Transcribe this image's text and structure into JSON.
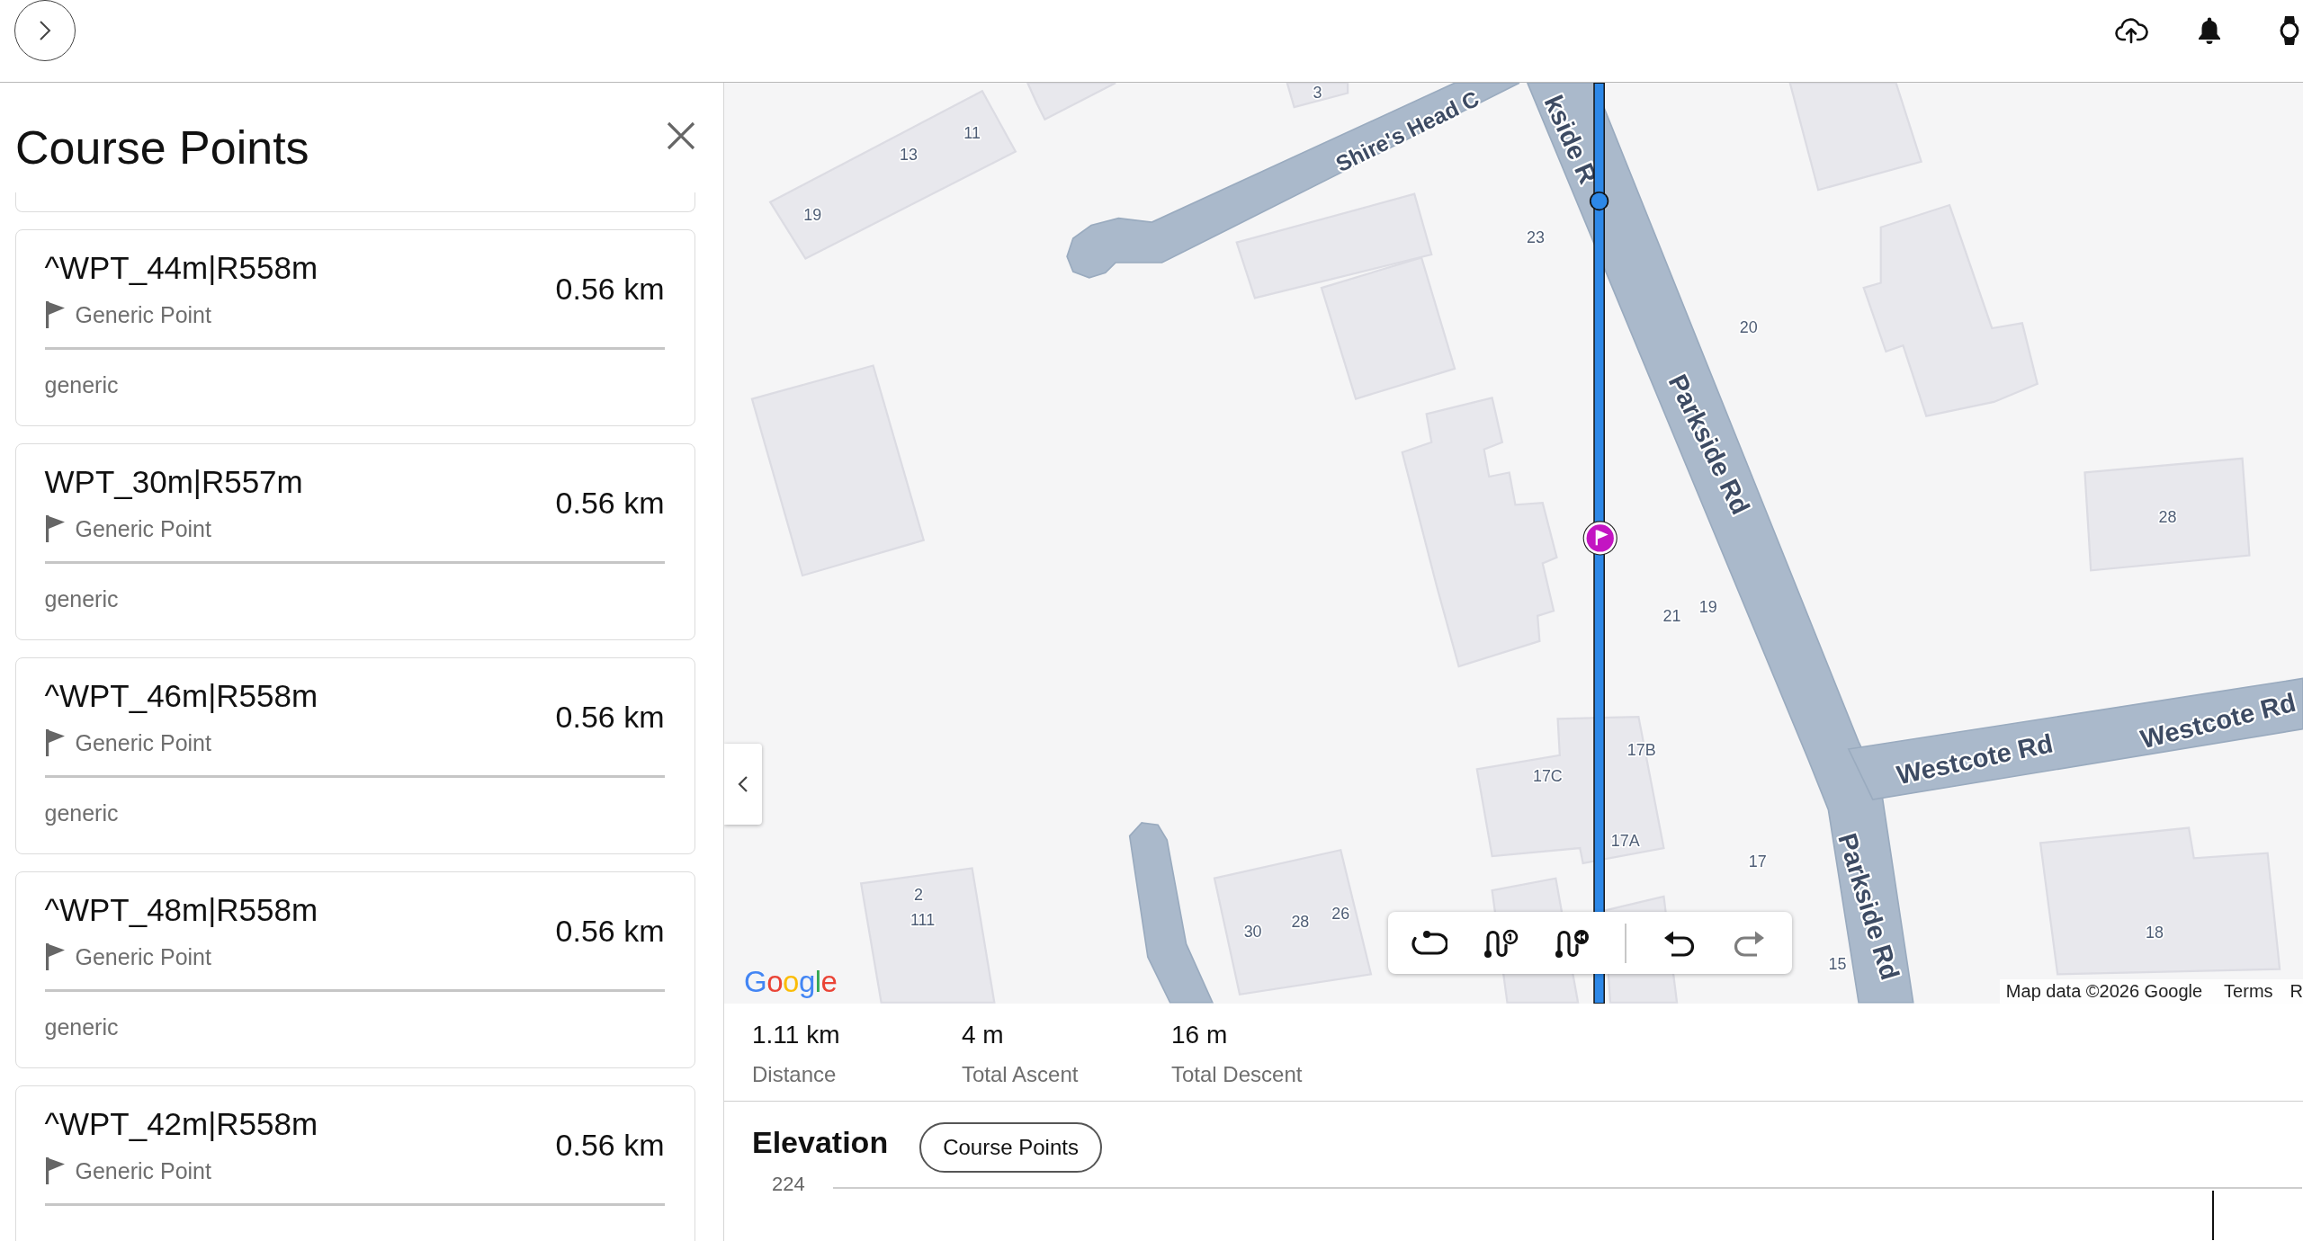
{
  "sidebar": {
    "title": "Course Points",
    "items": [
      {
        "name": "^WPT_44m|R558m",
        "type": "Generic Point",
        "distance": "0.56 km",
        "note": "generic"
      },
      {
        "name": "WPT_30m|R557m",
        "type": "Generic Point",
        "distance": "0.56 km",
        "note": "generic"
      },
      {
        "name": "^WPT_46m|R558m",
        "type": "Generic Point",
        "distance": "0.56 km",
        "note": "generic"
      },
      {
        "name": "^WPT_48m|R558m",
        "type": "Generic Point",
        "distance": "0.56 km",
        "note": "generic"
      },
      {
        "name": "^WPT_42m|R558m",
        "type": "Generic Point",
        "distance": "0.56 km"
      }
    ]
  },
  "map": {
    "street_labels": [
      "Shire's Head C",
      "kside R",
      "Parkside Rd",
      "Westcote Rd",
      "Westcote Rd",
      "Parkside Rd"
    ],
    "house_numbers": [
      "3",
      "11",
      "13",
      "19",
      "23",
      "20",
      "28",
      "19",
      "21",
      "17B",
      "17C",
      "17A",
      "17",
      "2",
      "26",
      "111",
      "28",
      "30",
      "18",
      "15"
    ],
    "logo": "Google",
    "attribution": "Map data ©2026 Google",
    "links": [
      "Terms",
      "R"
    ],
    "toolbar": [
      {
        "kind": "loop",
        "disabled": false
      },
      {
        "kind": "route-pin",
        "disabled": false
      },
      {
        "kind": "route-return",
        "disabled": false
      },
      {
        "kind": "undo",
        "disabled": false
      },
      {
        "kind": "redo",
        "disabled": true
      }
    ]
  },
  "stats": [
    {
      "value": "1.11 km",
      "label": "Distance"
    },
    {
      "value": "4 m",
      "label": "Total Ascent"
    },
    {
      "value": "16 m",
      "label": "Total Descent"
    }
  ],
  "elevation": {
    "title": "Elevation",
    "button": "Course Points",
    "axis_label": "224"
  }
}
